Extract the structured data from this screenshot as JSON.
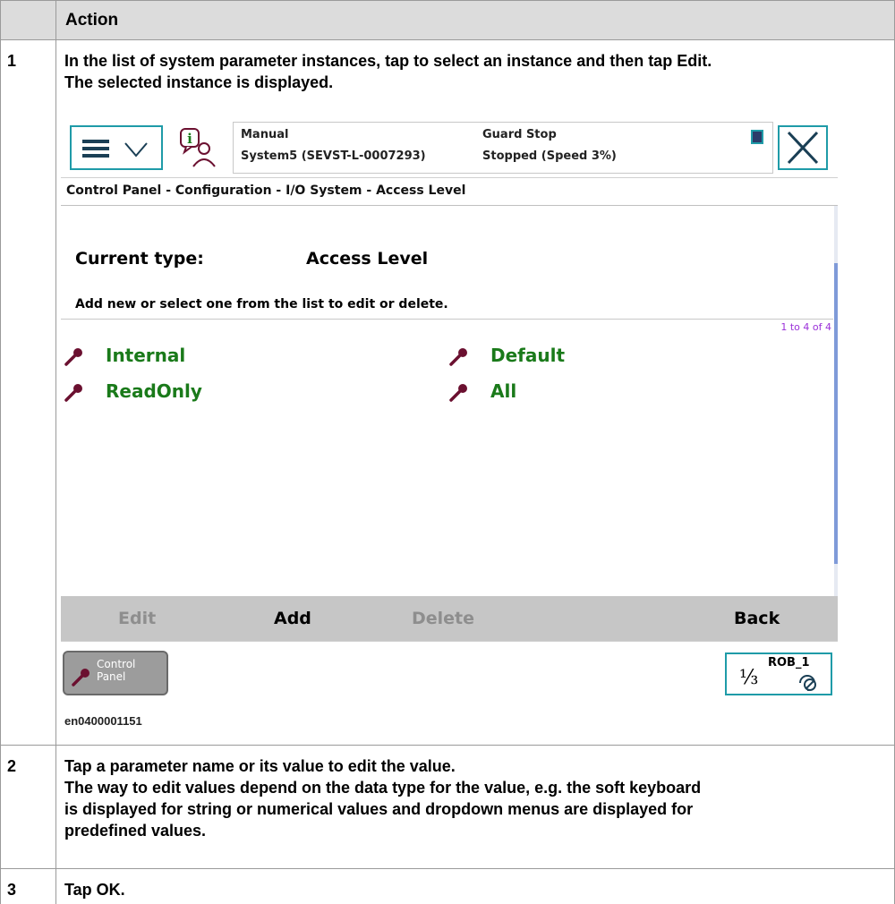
{
  "table": {
    "header_action": "Action",
    "steps": [
      {
        "num": "1",
        "text_before": "In the list of system parameter instances, tap to select an instance and then tap ",
        "text_bold": "Edit",
        "text_after": ".",
        "text_line2": "The selected instance is displayed."
      },
      {
        "num": "2",
        "line1": "Tap a parameter name or its value to edit the value.",
        "line2": "The way to edit values depend on the data type for the value, e.g. the soft keyboard",
        "line3": "is displayed for string or numerical values and dropdown menus are displayed for",
        "line4": "predefined values."
      },
      {
        "num": "3",
        "text_before": "Tap ",
        "text_bold": "OK",
        "text_after": "."
      }
    ],
    "figure_caption": "en0400001151"
  },
  "screen": {
    "status": {
      "mode": "Manual",
      "system": "System5 (SEVST-L-0007293)",
      "state": "Guard Stop",
      "speed": "Stopped (Speed 3%)"
    },
    "breadcrumb": "Control Panel - Configuration - I/O System - Access Level",
    "current_type_label": "Current type:",
    "current_type_value": "Access Level",
    "instruction": "Add new or select one from the list to edit or delete.",
    "range": "1 to 4 of 4",
    "items": [
      "Internal",
      "Default",
      "ReadOnly",
      "All"
    ],
    "commands": {
      "edit": "Edit",
      "add": "Add",
      "delete": "Delete",
      "back": "Back"
    },
    "taskbar": {
      "control_panel_line1": "Control",
      "control_panel_line2": "Panel",
      "rob_label": "ROB_1",
      "rob_fraction": "⅓"
    },
    "colors": {
      "accent": "#1f9ba8",
      "item_text": "#1a7a1a",
      "wrench": "#6b1030",
      "range_text": "#9b30d9",
      "command_bar": "#c6c6c6"
    }
  }
}
